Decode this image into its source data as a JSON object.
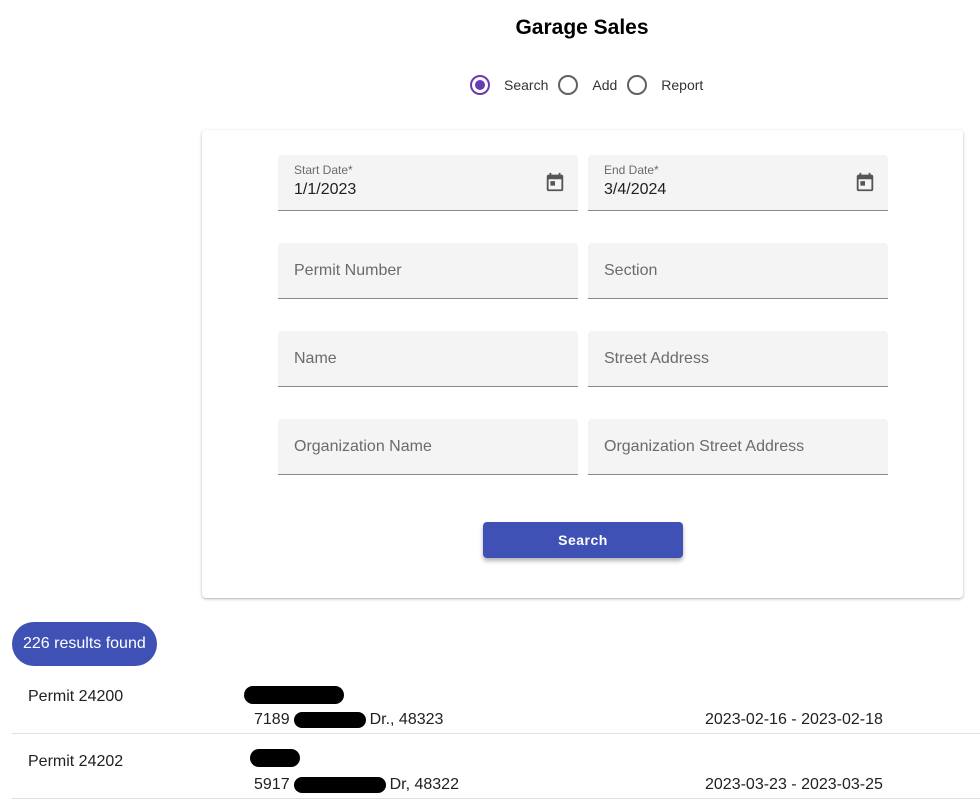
{
  "page": {
    "title": "Garage Sales"
  },
  "mode": {
    "options": [
      {
        "label": "Search",
        "selected": true
      },
      {
        "label": "Add",
        "selected": false
      },
      {
        "label": "Report",
        "selected": false
      }
    ]
  },
  "form": {
    "start_date": {
      "label": "Start Date*",
      "value": "1/1/2023"
    },
    "end_date": {
      "label": "End Date*",
      "value": "3/4/2024"
    },
    "permit_number": {
      "placeholder": "Permit Number"
    },
    "section": {
      "placeholder": "Section"
    },
    "name": {
      "placeholder": "Name"
    },
    "street_address": {
      "placeholder": "Street Address"
    },
    "organization_name": {
      "placeholder": "Organization Name"
    },
    "organization_street_address": {
      "placeholder": "Organization Street Address"
    },
    "search_label": "Search"
  },
  "results": {
    "count_label": "226 results found",
    "rows": [
      {
        "permit": "Permit 24200",
        "addr_prefix": "7189",
        "addr_suffix": "Dr., 48323",
        "dates": "2023-02-16 - 2023-02-18"
      },
      {
        "permit": "Permit 24202",
        "addr_prefix": "5917",
        "addr_suffix": "Dr, 48322",
        "dates": "2023-03-23 - 2023-03-25"
      }
    ]
  },
  "colors": {
    "accent": "#3f51b5",
    "radio_selected": "#673ab7",
    "field_bg": "#f4f4f4"
  },
  "icons": {
    "calendar": "calendar-icon",
    "radio": "radio-icon"
  }
}
